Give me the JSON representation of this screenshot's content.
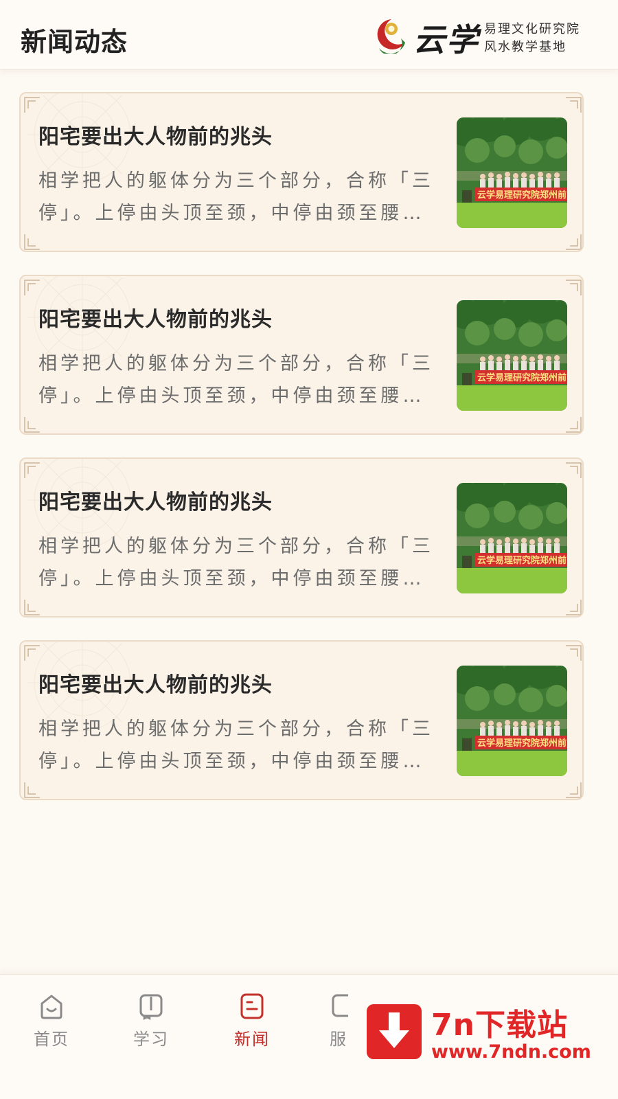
{
  "header": {
    "title": "新闻动态",
    "brand": {
      "name": "云学",
      "line1": "易理文化研究院",
      "line2": "风水教学基地"
    }
  },
  "news": [
    {
      "title": "阳宅要出大人物前的兆头",
      "summary": "相学把人的躯体分为三个部分，合称「三停」。上停由头顶至颈，中停由颈至腰，下...",
      "banner_text": "云学易理研究院郑州前"
    },
    {
      "title": "阳宅要出大人物前的兆头",
      "summary": "相学把人的躯体分为三个部分，合称「三停」。上停由头顶至颈，中停由颈至腰，下...",
      "banner_text": "云学易理研究院郑州前"
    },
    {
      "title": "阳宅要出大人物前的兆头",
      "summary": "相学把人的躯体分为三个部分，合称「三停」。上停由头顶至颈，中停由颈至腰，下...",
      "banner_text": "云学易理研究院郑州前"
    },
    {
      "title": "阳宅要出大人物前的兆头",
      "summary": "相学把人的躯体分为三个部分，合称「三停」。上停由头顶至颈，中停由颈至腰，下...",
      "banner_text": "云学易理研究院郑州前"
    }
  ],
  "tabbar": {
    "tabs": [
      {
        "label": "首页",
        "icon": "home-icon",
        "active": false
      },
      {
        "label": "学习",
        "icon": "book-icon",
        "active": false
      },
      {
        "label": "新闻",
        "icon": "news-icon",
        "active": true
      },
      {
        "label": "服",
        "icon": "service-icon",
        "active": false
      }
    ]
  },
  "watermark": {
    "name": "7n下载站",
    "url": "www.7ndn.com"
  },
  "colors": {
    "accent": "#c4302a",
    "card_background": "#fbf3e8",
    "card_border": "#ebdac6",
    "page_background": "#fdf9f3"
  }
}
